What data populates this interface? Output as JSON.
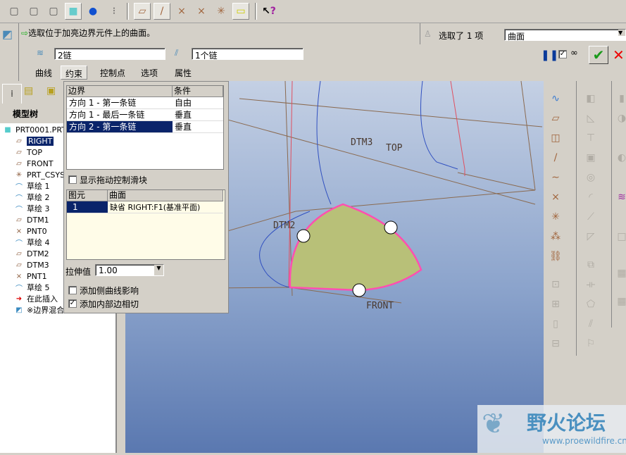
{
  "toolbar": {
    "icons": [
      "wireframe-icon",
      "hidden-line-icon",
      "no-hidden-icon",
      "shading-icon",
      "saved-views-icon",
      "model-tree-display-icon",
      "datum-plane-toggle-icon",
      "datum-axis-toggle-icon",
      "datum-point-toggle-icon",
      "point-tag-icon",
      "csys-toggle-icon",
      "annotation-toggle-icon",
      "context-help-icon"
    ]
  },
  "dashboard": {
    "message": "选取位于加亮边界元件上的曲面。",
    "dir1_chain": "2链",
    "dir2_chain": "1个链",
    "selected_count": "选取了 1 项",
    "filter": "曲面",
    "tabs": [
      "曲线",
      "约束",
      "控制点",
      "选项",
      "属性"
    ],
    "active_tab": "约束"
  },
  "tree": {
    "tabs_label": "模型树",
    "root": "PRT0001.PRT",
    "items": [
      {
        "label": "RIGHT",
        "icon": "datum-plane-icon",
        "selected": true
      },
      {
        "label": "TOP",
        "icon": "datum-plane-icon"
      },
      {
        "label": "FRONT",
        "icon": "datum-plane-icon"
      },
      {
        "label": "PRT_CSYS",
        "icon": "csys-icon"
      },
      {
        "label": "草绘 1",
        "icon": "sketch-icon"
      },
      {
        "label": "草绘 2",
        "icon": "sketch-icon"
      },
      {
        "label": "草绘 3",
        "icon": "sketch-icon"
      },
      {
        "label": "DTM1",
        "icon": "datum-plane-icon"
      },
      {
        "label": "PNT0",
        "icon": "datum-point-icon"
      },
      {
        "label": "草绘 4",
        "icon": "sketch-icon"
      },
      {
        "label": "DTM2",
        "icon": "datum-plane-icon"
      },
      {
        "label": "DTM3",
        "icon": "datum-plane-icon"
      },
      {
        "label": "PNT1",
        "icon": "datum-point-icon"
      },
      {
        "label": "草绘 5",
        "icon": "sketch-icon"
      },
      {
        "label": "在此插入",
        "icon": "insert-arrow-icon"
      },
      {
        "label": "※边界混合",
        "icon": "boundary-blend-icon"
      }
    ]
  },
  "constraints": {
    "headers": [
      "边界",
      "条件"
    ],
    "rows": [
      [
        "方向 1 - 第一条链",
        "自由"
      ],
      [
        "方向 1 - 最后一条链",
        "垂直"
      ],
      [
        "方向 2 - 第一条链",
        "垂直"
      ]
    ],
    "selected_row": 2,
    "show_drag": "显示拖动控制滑块",
    "show_drag_checked": false,
    "ref_headers": [
      "图元",
      "曲面"
    ],
    "ref_rows": [
      [
        "1",
        "缺省 RIGHT:F1(基准平面)"
      ]
    ],
    "stretch_label": "拉伸值",
    "stretch_value": "1.00",
    "side_curve": "添加侧曲线影响",
    "side_curve_checked": false,
    "inner_tangent": "添加内部边相切",
    "inner_tangent_checked": true
  },
  "viewport": {
    "labels": {
      "dtm3": "DTM3",
      "top": "TOP",
      "dtm2": "DTM2",
      "front": "FRONT"
    },
    "surface_color": "#b8c078",
    "edge_color": "#ff4fb0"
  },
  "watermark": {
    "title": "野火论坛",
    "url": "www.proewildfire.cn"
  }
}
